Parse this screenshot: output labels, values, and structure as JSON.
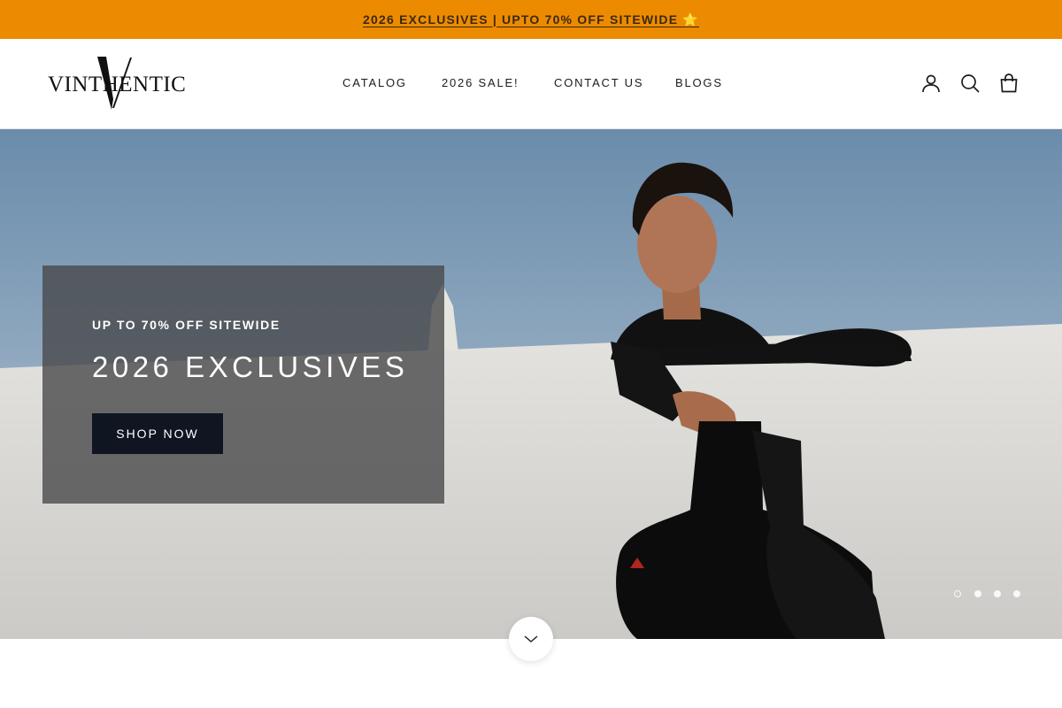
{
  "announcement": {
    "text": "2026 EXCLUSIVES | UPTO 70% OFF SITEWIDE ⭐"
  },
  "header": {
    "logo_text": "VINTHENTIC",
    "nav": {
      "catalog": "CATALOG",
      "sale": "2026 SALE!",
      "contact": "CONTACT US",
      "blogs": "BLOGS"
    },
    "icons": [
      "account-icon",
      "search-icon",
      "cart-icon"
    ]
  },
  "hero": {
    "subtitle": "UP TO 70% OFF SITEWIDE",
    "title": "2026 EXCLUSIVES",
    "cta_label": "SHOP NOW",
    "slides_total": 4,
    "active_slide": 1
  },
  "colors": {
    "announcement_bg": "#ed8b00",
    "cta_bg": "#101522",
    "promo_box_bg": "#464648"
  }
}
